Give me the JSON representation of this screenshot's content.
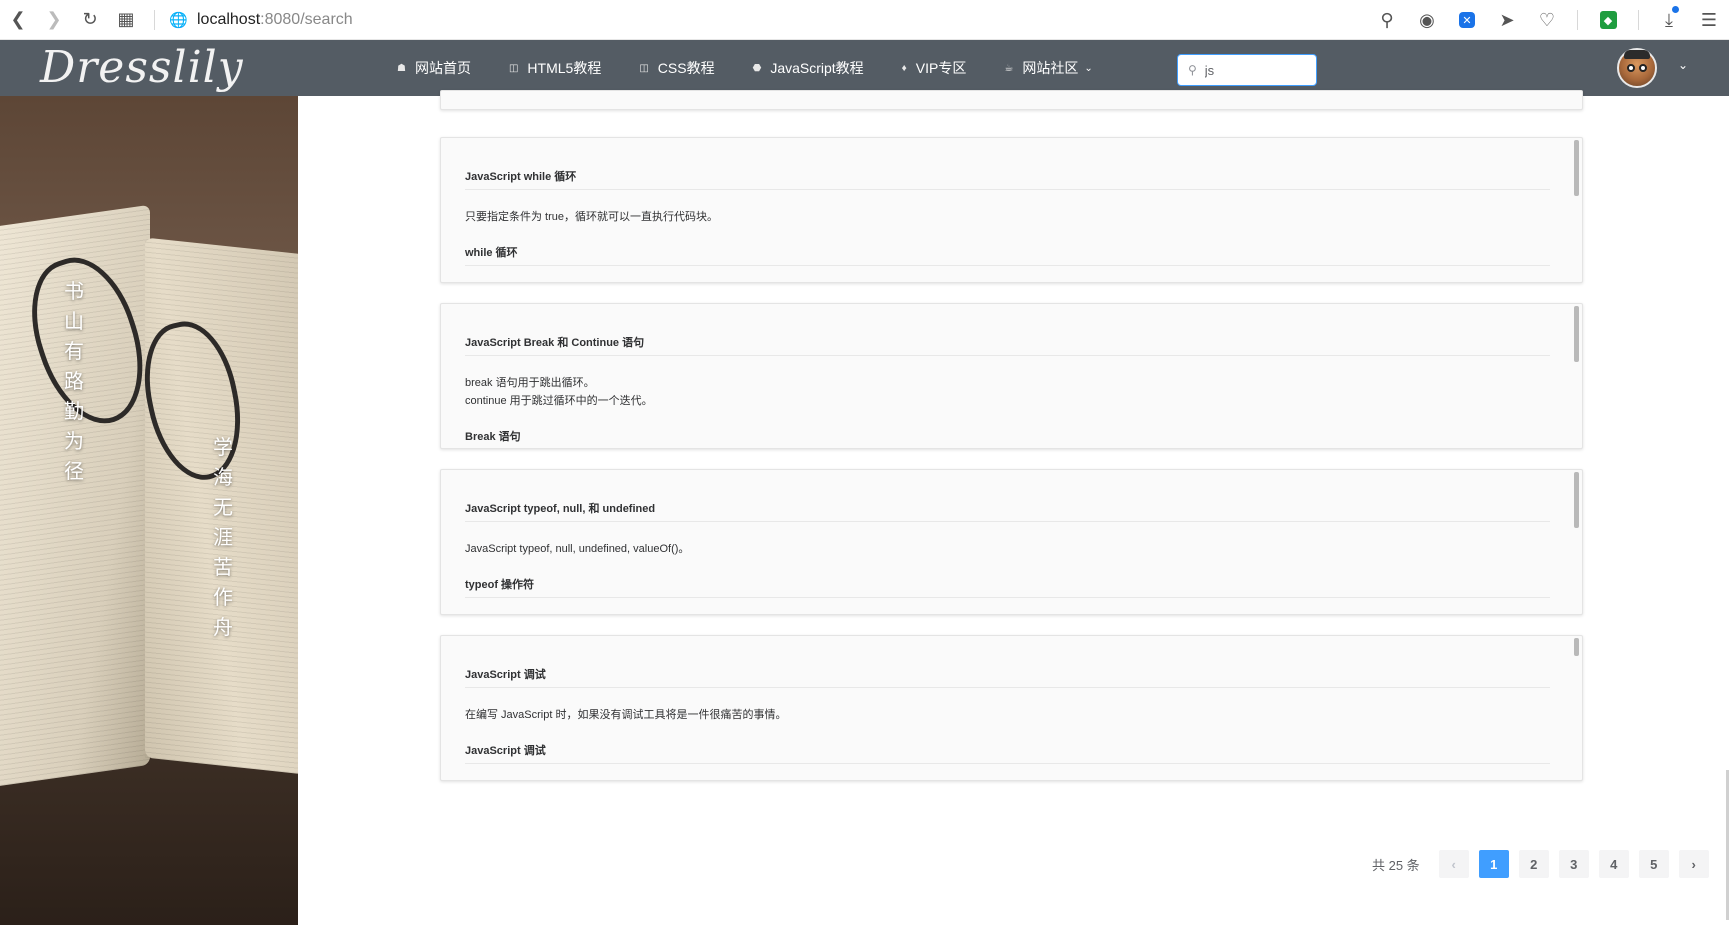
{
  "browser": {
    "url_host": "localhost",
    "url_rest": ":8080/search"
  },
  "nav": {
    "logo": "Dresslily",
    "items": [
      {
        "label": "网站首页",
        "icon": "home-icon"
      },
      {
        "label": "HTML5教程",
        "icon": "html5-icon"
      },
      {
        "label": "CSS教程",
        "icon": "css3-icon"
      },
      {
        "label": "JavaScript教程",
        "icon": "js-icon"
      },
      {
        "label": "VIP专区",
        "icon": "vip-icon"
      },
      {
        "label": "网站社区",
        "icon": "community-icon"
      }
    ],
    "search_value": "js"
  },
  "side": {
    "poem_left": [
      "书",
      "山",
      "有",
      "路",
      "勤",
      "为",
      "径"
    ],
    "poem_right": [
      "学",
      "海",
      "无",
      "涯",
      "苦",
      "作",
      "舟"
    ]
  },
  "cards": [
    {
      "title": "JavaScript while 循环",
      "lines": [
        "只要指定条件为 true，循环就可以一直执行代码块。"
      ],
      "subtitle": "while 循环"
    },
    {
      "title": "JavaScript Break 和 Continue 语句",
      "lines": [
        "break 语句用于跳出循环。",
        "continue 用于跳过循环中的一个迭代。"
      ],
      "subtitle": "Break 语句"
    },
    {
      "title": "JavaScript typeof, null, 和 undefined",
      "lines": [
        "JavaScript typeof, null, undefined, valueOf()。"
      ],
      "subtitle": "typeof 操作符"
    },
    {
      "title": "JavaScript 调试",
      "lines": [
        "在编写 JavaScript 时，如果没有调试工具将是一件很痛苦的事情。"
      ],
      "subtitle": "JavaScript 调试"
    }
  ],
  "pagination": {
    "total_label": "共 25 条",
    "pages": [
      "1",
      "2",
      "3",
      "4",
      "5"
    ],
    "current": "1",
    "prev": "‹",
    "next": "›"
  }
}
